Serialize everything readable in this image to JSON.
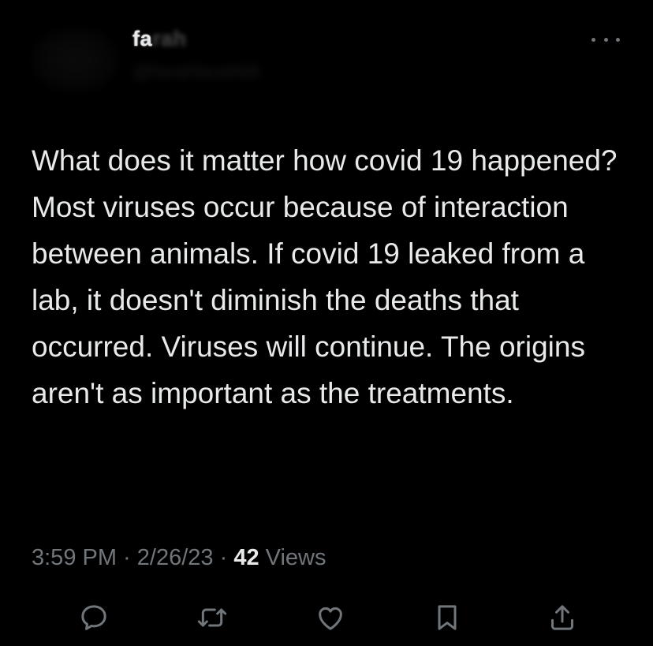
{
  "header": {
    "display_name_visible": "fa",
    "display_name_blurred": "rah",
    "handle": "@farahfarah69"
  },
  "tweet": {
    "text": "What does it matter how covid 19 happened? Most viruses occur because of interaction between animals. If covid 19 leaked from a lab, it doesn't diminish the deaths that occurred. Viruses will continue. The origins aren't as important as the treatments."
  },
  "meta": {
    "time": "3:59 PM",
    "separator": " · ",
    "date": "2/26/23",
    "views_count": "42",
    "views_label": " Views"
  },
  "actions": [
    {
      "name": "reply",
      "icon": "speech-bubble-icon"
    },
    {
      "name": "retweet",
      "icon": "retweet-icon"
    },
    {
      "name": "like",
      "icon": "heart-icon"
    },
    {
      "name": "bookmark",
      "icon": "bookmark-icon"
    },
    {
      "name": "share",
      "icon": "share-icon"
    }
  ],
  "colors": {
    "background": "#000000",
    "text_primary": "#e7e9ea",
    "text_secondary": "#71767b",
    "icon": "#71767b"
  }
}
